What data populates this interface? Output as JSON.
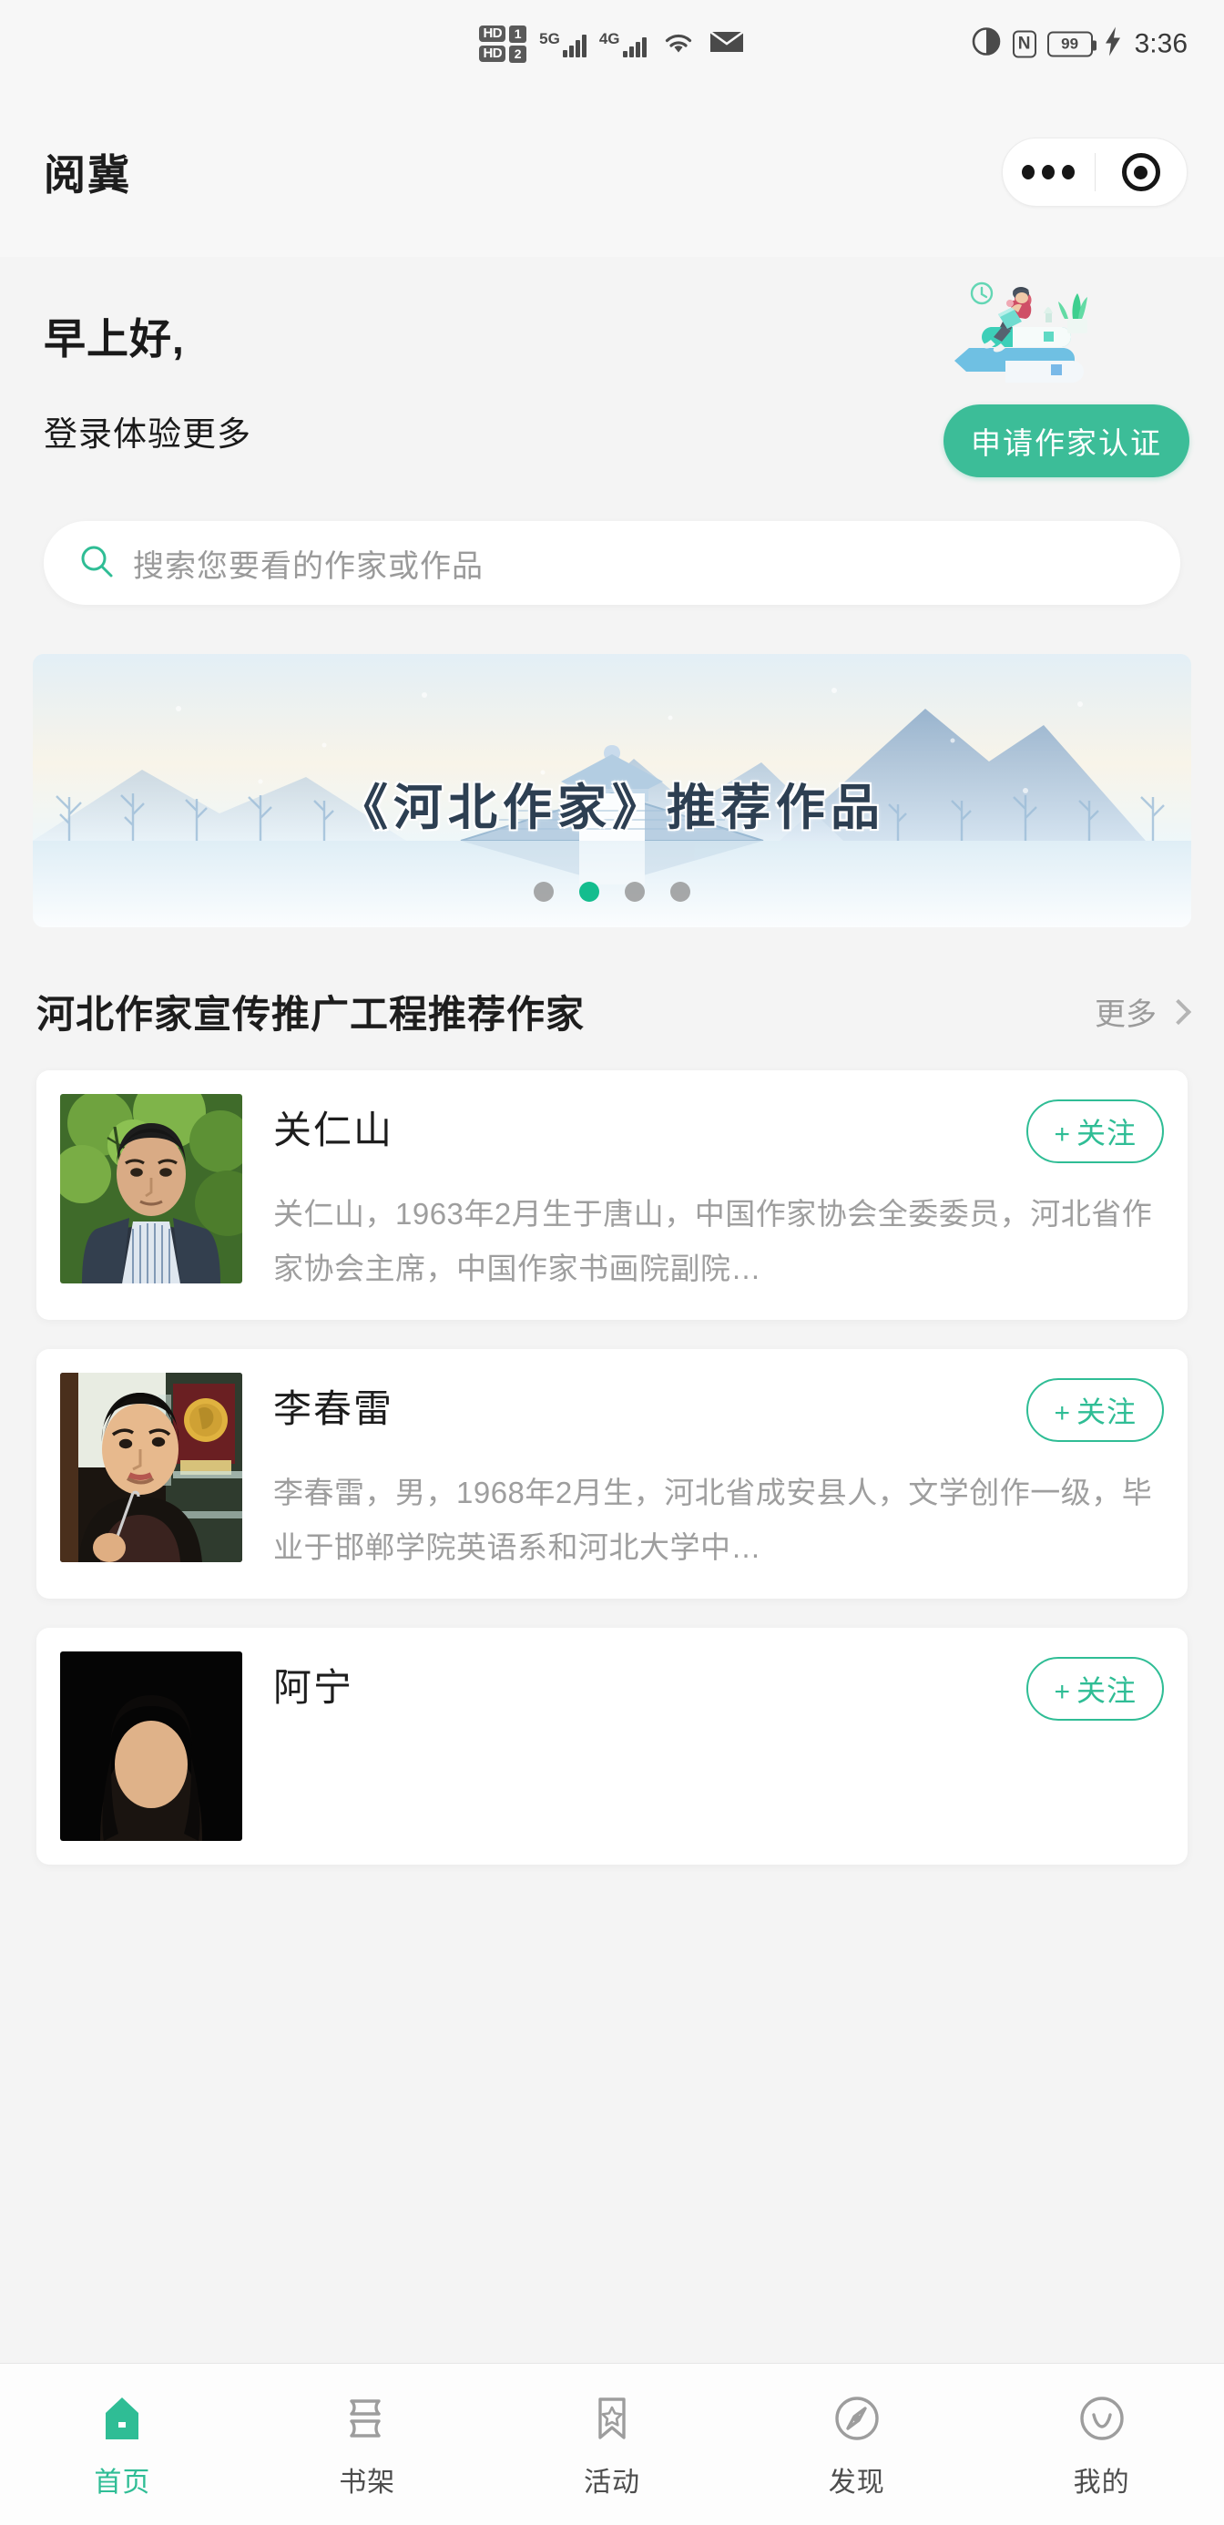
{
  "status_bar": {
    "hd1_label": "HD",
    "sim1_label": "1",
    "hd2_label": "HD",
    "sim2_label": "2",
    "network_1": "5G",
    "network_2": "4G",
    "wifi_icon": "wifi-icon",
    "mail_icon": "mail-icon",
    "eye_comfort_icon": "eye-comfort-icon",
    "nfc_label": "N",
    "battery_level": "99",
    "charging_icon": "charging-bolt-icon",
    "time": "3:36"
  },
  "navbar": {
    "title": "阅冀",
    "more_icon": "more-dots-icon",
    "close_icon": "target-circle-icon"
  },
  "greeting": {
    "main": "早上好,",
    "sub": "登录体验更多",
    "illustration_icon": "person-reading-on-books-illustration",
    "cert_button": "申请作家认证"
  },
  "search": {
    "icon": "search-icon",
    "placeholder": "搜索您要看的作家或作品"
  },
  "banner": {
    "title": "《河北作家》推荐作品",
    "dots_total": 4,
    "active_dot": 2
  },
  "section": {
    "title": "河北作家宣传推广工程推荐作家",
    "more_label": "更多",
    "more_icon": "chevron-right-icon"
  },
  "authors": [
    {
      "name": "关仁山",
      "bio": "关仁山，1963年2月生于唐山，中国作家协会全委委员，河北省作家协会主席，中国作家书画院副院…",
      "follow_label": "关注",
      "follow_plus": "+",
      "avatar_icon": "author-portrait-guanrenshan"
    },
    {
      "name": "李春雷",
      "bio": "李春雷，男，1968年2月生，河北省成安县人，文学创作一级，毕业于邯郸学院英语系和河北大学中…",
      "follow_label": "关注",
      "follow_plus": "+",
      "avatar_icon": "author-portrait-lichunlei"
    },
    {
      "name": "阿宁",
      "bio": "",
      "follow_label": "关注",
      "follow_plus": "+",
      "avatar_icon": "author-portrait-aning"
    }
  ],
  "tabbar": [
    {
      "label": "首页",
      "icon": "home-icon",
      "active": true
    },
    {
      "label": "书架",
      "icon": "bookshelf-icon",
      "active": false
    },
    {
      "label": "活动",
      "icon": "bookmark-star-icon",
      "active": false
    },
    {
      "label": "发现",
      "icon": "compass-icon",
      "active": false
    },
    {
      "label": "我的",
      "icon": "profile-smiley-icon",
      "active": false
    }
  ],
  "colors": {
    "accent_green": "#2fbd95",
    "dot_active": "#14bd8e",
    "bg": "#f4f4f4",
    "card_bg": "#ffffff",
    "text_primary": "#1d1d1d",
    "text_muted": "#9e9e9e"
  }
}
